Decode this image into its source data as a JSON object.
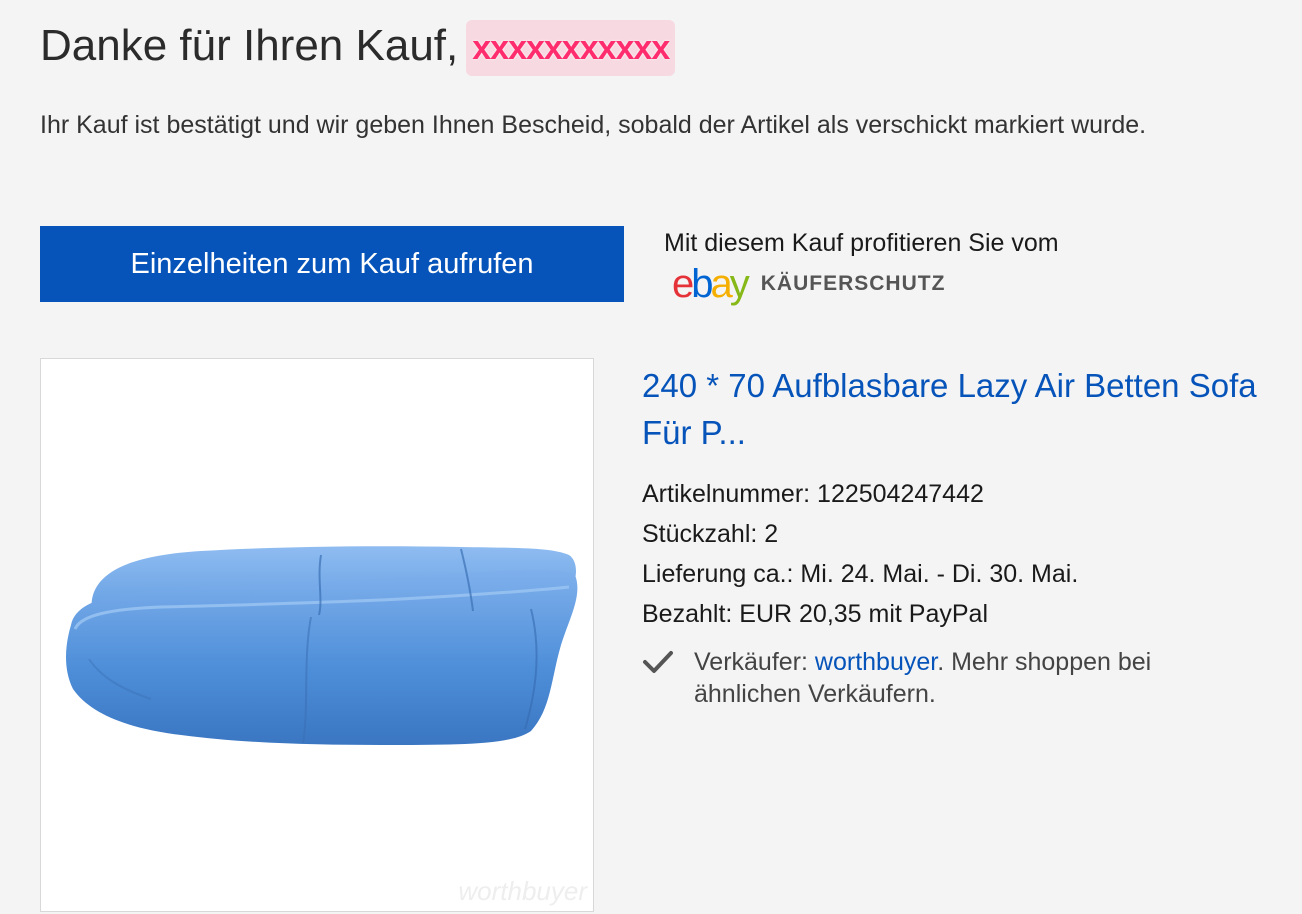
{
  "header": {
    "title": "Danke für Ihren Kauf,",
    "buyer_name_redacted": "xxxxxxxxxxx"
  },
  "message": {
    "text": "Ihr Kauf ist bestätigt und wir geben Ihnen Bescheid, sobald der Artikel als verschickt markiert wurde."
  },
  "actions": {
    "view_details_label": "Einzelheiten zum Kauf aufrufen"
  },
  "protection": {
    "text": "Mit diesem Kauf profitieren Sie vom",
    "logo_letters": [
      "e",
      "b",
      "a",
      "y"
    ],
    "logo_label": "KÄUFERSCHUTZ"
  },
  "product": {
    "title": "240 * 70 Aufblasbare Lazy Air Betten Sofa Für P...",
    "image_icon": "inflatable-air-sofa-image",
    "image_watermark": "worthbuyer",
    "details": [
      "Artikelnummer: 122504247442",
      "Stückzahl: 2",
      "Lieferung ca.: Mi. 24. Mai. - Di. 30. Mai.",
      "Bezahlt: EUR 20,35 mit PayPal"
    ]
  },
  "seller": {
    "icon": "checkmark-icon",
    "prefix": "Verkäufer: ",
    "name": "worthbuyer",
    "suffix": ". Mehr shoppen bei ähnlichen Verkäufern."
  },
  "colors": {
    "background": "#f4f4f4",
    "button": "#0654ba",
    "link": "#0654ba",
    "product_blue": "#4f8fd9",
    "ebay_e": "#e53238",
    "ebay_b": "#0064d2",
    "ebay_a": "#f5af02",
    "ebay_y": "#86b817"
  }
}
